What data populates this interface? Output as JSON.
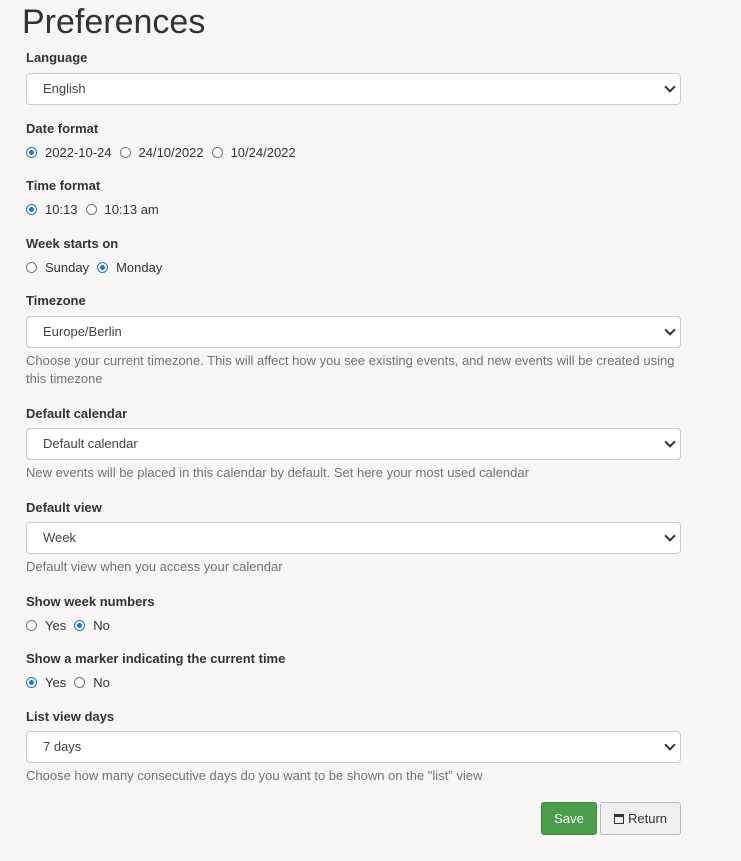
{
  "page": {
    "title": "Preferences"
  },
  "language": {
    "label": "Language",
    "value": "English"
  },
  "date_format": {
    "label": "Date format",
    "options": [
      {
        "label": "2022-10-24",
        "selected": true
      },
      {
        "label": "24/10/2022",
        "selected": false
      },
      {
        "label": "10/24/2022",
        "selected": false
      }
    ]
  },
  "time_format": {
    "label": "Time format",
    "options": [
      {
        "label": "10:13",
        "selected": true
      },
      {
        "label": "10:13 am",
        "selected": false
      }
    ]
  },
  "week_start": {
    "label": "Week starts on",
    "options": [
      {
        "label": "Sunday",
        "selected": false
      },
      {
        "label": "Monday",
        "selected": true
      }
    ]
  },
  "timezone": {
    "label": "Timezone",
    "value": "Europe/Berlin",
    "help": "Choose your current timezone. This will affect how you see existing events, and new events will be created using this timezone"
  },
  "default_calendar": {
    "label": "Default calendar",
    "value": "Default calendar",
    "help": "New events will be placed in this calendar by default. Set here your most used calendar"
  },
  "default_view": {
    "label": "Default view",
    "value": "Week",
    "help": "Default view when you access your calendar"
  },
  "week_numbers": {
    "label": "Show week numbers",
    "options": [
      {
        "label": "Yes",
        "selected": false
      },
      {
        "label": "No",
        "selected": true
      }
    ]
  },
  "time_marker": {
    "label": "Show a marker indicating the current time",
    "options": [
      {
        "label": "Yes",
        "selected": true
      },
      {
        "label": "No",
        "selected": false
      }
    ]
  },
  "list_view_days": {
    "label": "List view days",
    "value": "7 days",
    "help": "Choose how many consecutive days do you want to be shown on the \"list\" view"
  },
  "actions": {
    "save": "Save",
    "return": "Return"
  },
  "colors": {
    "accent": "#1a73e8",
    "save": "#4a9e4a",
    "help_text": "#737373"
  }
}
